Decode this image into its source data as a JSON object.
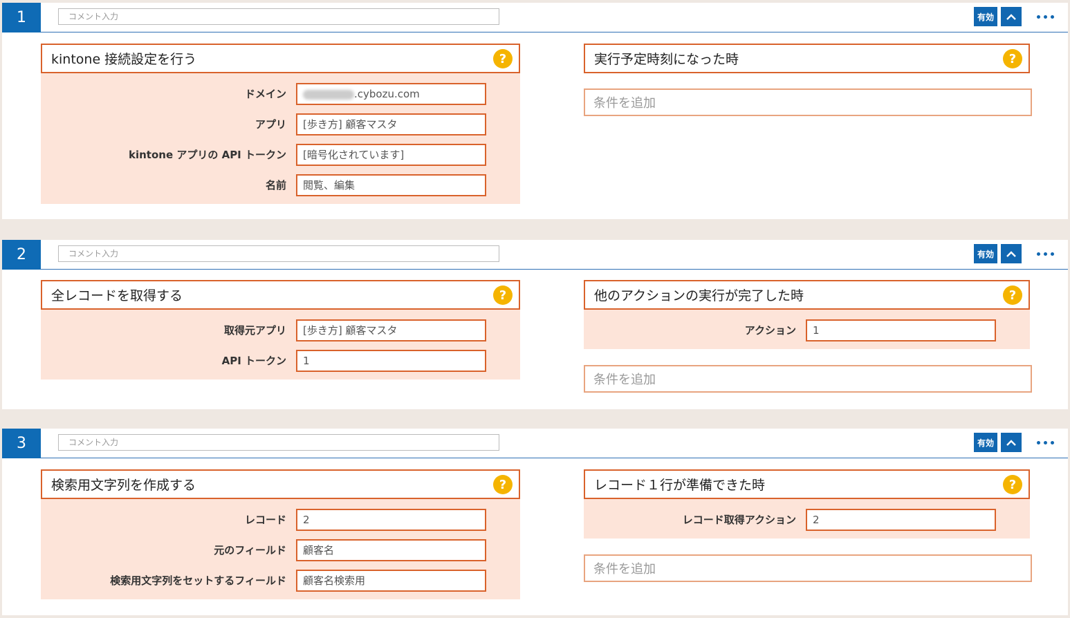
{
  "steps": [
    {
      "number": "1",
      "comment_placeholder": "コメント入力",
      "enabled_label": "有効",
      "action": {
        "title": "kintone 接続設定を行う",
        "fields": [
          {
            "label": "ドメイン",
            "value": ".cybozu.com",
            "blurred_prefix": true
          },
          {
            "label": "アプリ",
            "value": "[歩き方] 顧客マスタ"
          },
          {
            "label": "kintone アプリの API トークン",
            "value": "[暗号化されています]"
          },
          {
            "label": "名前",
            "value": "閲覧、編集"
          }
        ]
      },
      "trigger": {
        "title": "実行予定時刻になった時",
        "fields": [],
        "add_condition_label": "条件を追加"
      }
    },
    {
      "number": "2",
      "comment_placeholder": "コメント入力",
      "enabled_label": "有効",
      "action": {
        "title": "全レコードを取得する",
        "fields": [
          {
            "label": "取得元アプリ",
            "value": "[歩き方] 顧客マスタ"
          },
          {
            "label": "API トークン",
            "value": "1"
          }
        ]
      },
      "trigger": {
        "title": "他のアクションの実行が完了した時",
        "fields": [
          {
            "label": "アクション",
            "value": "1"
          }
        ],
        "add_condition_label": "条件を追加"
      }
    },
    {
      "number": "3",
      "comment_placeholder": "コメント入力",
      "enabled_label": "有効",
      "action": {
        "title": "検索用文字列を作成する",
        "fields": [
          {
            "label": "レコード",
            "value": "2"
          },
          {
            "label": "元のフィールド",
            "value": "顧客名"
          },
          {
            "label": "検索用文字列をセットするフィールド",
            "value": "顧客名検索用"
          }
        ]
      },
      "trigger": {
        "title": "レコード１行が準備できた時",
        "fields": [
          {
            "label": "レコード取得アクション",
            "value": "2"
          }
        ],
        "add_condition_label": "条件を追加"
      }
    }
  ],
  "colors": {
    "accent_blue": "#1167b1",
    "panel_border": "#d9622b",
    "panel_fill": "#fde4d9",
    "help_icon": "#f5b400"
  }
}
